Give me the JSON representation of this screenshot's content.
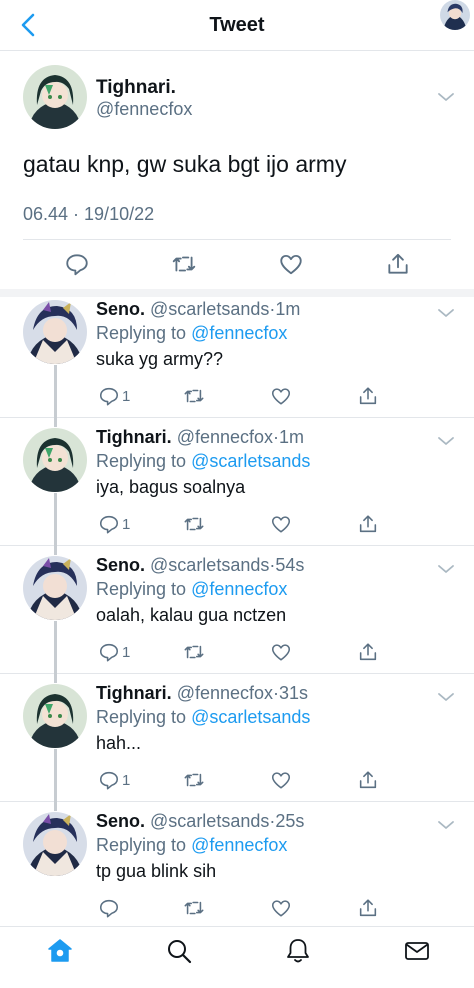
{
  "header": {
    "title": "Tweet"
  },
  "main_tweet": {
    "name": "Tighnari.",
    "handle": "@fennecfox",
    "text": "gatau knp, gw suka bgt ijo army",
    "timestamp": "06.44 · 19/10/22"
  },
  "replies": [
    {
      "name": "Seno.",
      "handle": "@scarletsands",
      "time": "·1m",
      "replying_prefix": "Replying to ",
      "replying_to": "@fennecfox",
      "text": "suka yg army??",
      "reply_count": "1",
      "avatar": "seno"
    },
    {
      "name": "Tighnari.",
      "handle": "@fennecfox",
      "time": "·1m",
      "replying_prefix": "Replying to ",
      "replying_to": "@scarletsands",
      "text": "iya, bagus soalnya",
      "reply_count": "1",
      "avatar": "tighnari"
    },
    {
      "name": "Seno.",
      "handle": "@scarletsands",
      "time": "·54s",
      "replying_prefix": "Replying to ",
      "replying_to": "@fennecfox",
      "text": "oalah, kalau gua nctzen",
      "reply_count": "1",
      "avatar": "seno"
    },
    {
      "name": "Tighnari.",
      "handle": "@fennecfox",
      "time": "·31s",
      "replying_prefix": "Replying to ",
      "replying_to": "@scarletsands",
      "text": "hah...",
      "reply_count": "1",
      "avatar": "tighnari"
    },
    {
      "name": "Seno.",
      "handle": "@scarletsands",
      "time": "·25s",
      "replying_prefix": "Replying to ",
      "replying_to": "@fennecfox",
      "text": "tp gua blink sih",
      "reply_count": "",
      "avatar": "seno"
    }
  ],
  "colors": {
    "accent": "#1d9bf0",
    "secondary_text": "#5b7083",
    "divider": "#e3e6ea"
  },
  "icons": {
    "header": [
      "back-chevron-icon",
      "profile-avatar"
    ],
    "tweet_actions": [
      "reply-icon",
      "retweet-icon",
      "like-icon",
      "share-icon"
    ],
    "tabbar": [
      "home-icon",
      "search-icon",
      "notifications-icon",
      "messages-icon"
    ]
  }
}
